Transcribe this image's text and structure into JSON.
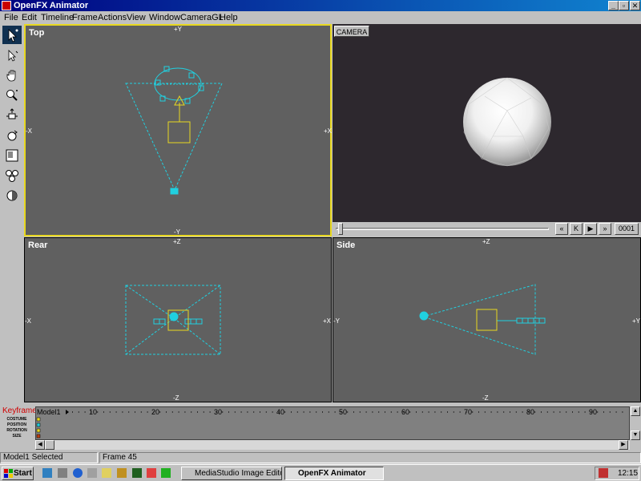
{
  "window": {
    "title": "OpenFX Animator",
    "controls": [
      "_",
      "▫",
      "✕"
    ]
  },
  "menu": [
    "File",
    "Edit",
    "Timeline",
    "Frame",
    "Actions",
    "View",
    "Window",
    "CameraGL",
    "Help"
  ],
  "tools": [
    "select-tool",
    "pointer-tool",
    "pan-tool",
    "zoom-tool",
    "move-tool",
    "rotate-tool",
    "frame-tool",
    "group-tool",
    "sphere-tool"
  ],
  "viewports": {
    "top": {
      "label": "Top",
      "axis_top": "+Y",
      "axis_bottom": "-Y",
      "axis_left": "-X",
      "axis_right": "+X"
    },
    "rear": {
      "label": "Rear",
      "axis_top": "+Z",
      "axis_bottom": "-Z",
      "axis_left": "-X",
      "axis_right": "+X"
    },
    "side": {
      "label": "Side",
      "axis_top": "+Z",
      "axis_bottom": "-Z",
      "axis_left": "-Y",
      "axis_right": "+Y"
    }
  },
  "camera": {
    "tab_label": "CAMERA",
    "buttons": [
      "«",
      "K",
      "▶",
      "»"
    ],
    "frame_number": "0001"
  },
  "keyframer": {
    "label": "Keyframer",
    "rows": [
      "COSTUME",
      "POSITION",
      "ROTATION",
      "SIZE"
    ],
    "model_name": "Model1",
    "ticks": [
      "10",
      "20",
      "30",
      "40",
      "50",
      "60",
      "70",
      "80",
      "90"
    ]
  },
  "status": {
    "selection": "Model1 Selected",
    "frame": "Frame 45"
  },
  "taskbar": {
    "start": "Start",
    "tasks": [
      "MediaStudio Image Editor",
      "OpenFX Animator"
    ],
    "clock": "12:15"
  },
  "colors": {
    "title_gradient_start": "#000080",
    "wireframe_cyan": "#20d0e0",
    "model_yellow": "#e8d820",
    "viewport_bg": "#606060",
    "camera_bg": "#2d282e"
  }
}
